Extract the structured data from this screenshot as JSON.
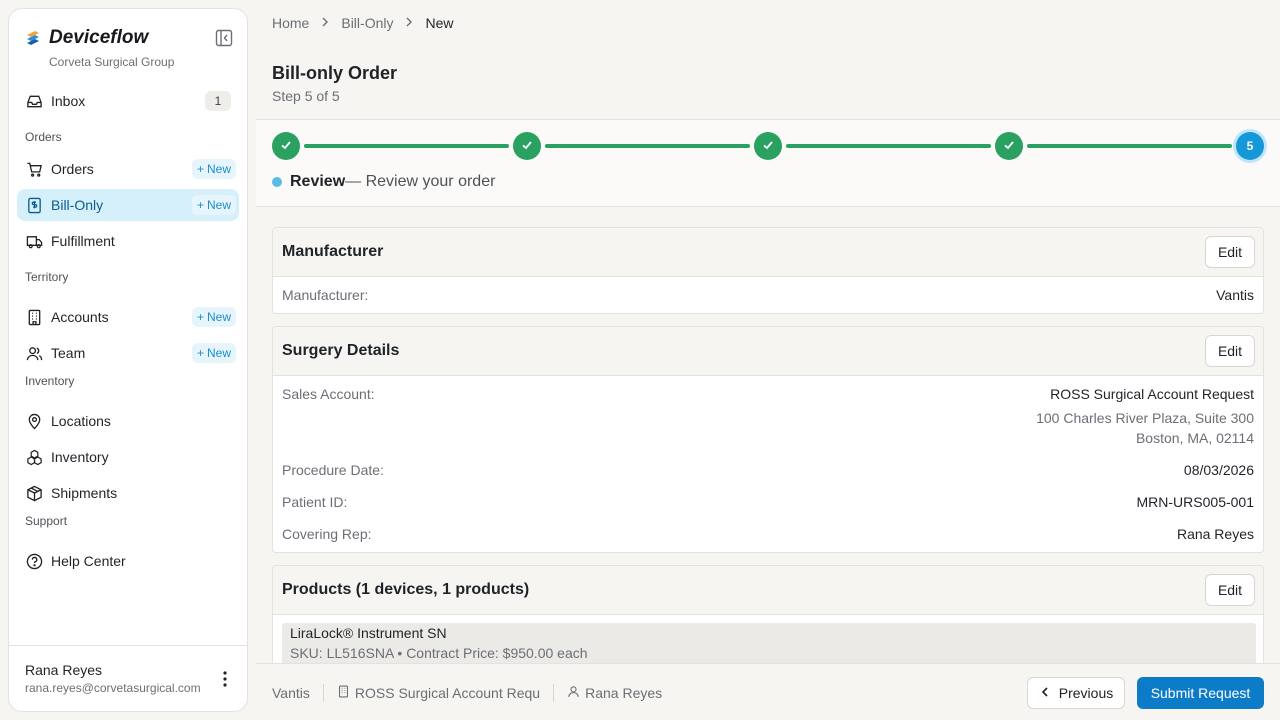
{
  "brand": {
    "name": "Deviceflow",
    "org": "Corveta Surgical Group"
  },
  "sidebar": {
    "inbox": {
      "label": "Inbox",
      "count": "1"
    },
    "sections": {
      "orders": "Orders",
      "territory": "Territory",
      "inventory": "Inventory",
      "support": "Support"
    },
    "new_label": "New",
    "items": {
      "orders": "Orders",
      "bill_only": "Bill-Only",
      "fulfillment": "Fulfillment",
      "accounts": "Accounts",
      "team": "Team",
      "locations": "Locations",
      "inventory": "Inventory",
      "shipments": "Shipments",
      "help_center": "Help Center"
    },
    "user": {
      "name": "Rana Reyes",
      "email": "rana.reyes@corvetasurgical.com"
    }
  },
  "breadcrumb": [
    "Home",
    "Bill-Only",
    "New"
  ],
  "page": {
    "title": "Bill-only Order",
    "step": "Step 5 of 5"
  },
  "stepper": {
    "steps_completed": 4,
    "current_number": "5",
    "current_label": "Review",
    "current_desc": "— Review your order"
  },
  "manufacturer_card": {
    "title": "Manufacturer",
    "edit": "Edit",
    "label": "Manufacturer:",
    "value": "Vantis"
  },
  "surgery_card": {
    "title": "Surgery Details",
    "edit": "Edit",
    "sales_account_label": "Sales Account:",
    "sales_account": "ROSS Surgical Account Request",
    "address_line1": "100 Charles River Plaza, Suite 300",
    "address_line2": "Boston, MA, 02114",
    "procedure_date_label": "Procedure Date:",
    "procedure_date": "08/03/2026",
    "patient_id_label": "Patient ID:",
    "patient_id": "MRN-URS005-001",
    "covering_rep_label": "Covering Rep:",
    "covering_rep": "Rana Reyes"
  },
  "products_card": {
    "title": "Products (1 devices, 1 products)",
    "edit": "Edit",
    "product_name": "LiraLock® Instrument SN",
    "product_meta": "SKU: LL516SNA • Contract Price: $950.00 each"
  },
  "footer": {
    "manufacturer": "Vantis",
    "account": "ROSS Surgical Account Requ",
    "rep": "Rana Reyes",
    "previous": "Previous",
    "submit": "Submit Request"
  },
  "colors": {
    "accent": "#0c7cc9",
    "success": "#2aa160",
    "current_step": "#1598d8",
    "active_nav_bg": "#d6f0fb"
  }
}
